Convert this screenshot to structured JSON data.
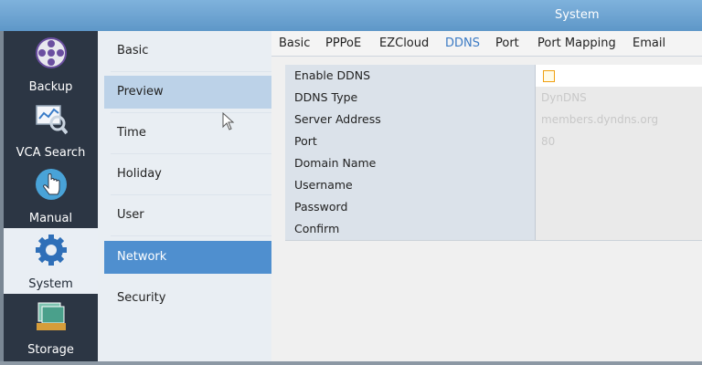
{
  "window": {
    "title": "System"
  },
  "nav": [
    {
      "label": "Backup",
      "icon": "film-reel-icon"
    },
    {
      "label": "VCA Search",
      "icon": "chart-magnifier-icon"
    },
    {
      "label": "Manual",
      "icon": "hand-pointer-icon"
    },
    {
      "label": "System",
      "icon": "gear-icon",
      "active": true
    },
    {
      "label": "Storage",
      "icon": "storage-icon"
    }
  ],
  "submenu": [
    {
      "label": "Basic"
    },
    {
      "label": "Preview"
    },
    {
      "label": "Time"
    },
    {
      "label": "Holiday"
    },
    {
      "label": "User"
    },
    {
      "label": "Network"
    },
    {
      "label": "Security"
    }
  ],
  "tabs": [
    "Basic",
    "PPPoE",
    "EZCloud",
    "DDNS",
    "Port",
    "Port Mapping",
    "Email"
  ],
  "active_tab": "DDNS",
  "form": {
    "enable_ddns": "Enable DDNS",
    "ddns_type": "DDNS Type",
    "ddns_type_value": "DynDNS",
    "server_address": "Server Address",
    "server_address_value": "members.dyndns.org",
    "port": "Port",
    "port_value": "80",
    "domain_name": "Domain Name",
    "username": "Username",
    "password": "Password",
    "confirm": "Confirm"
  },
  "colors": {
    "accent": "#4f8fcf",
    "nav_bg": "#2c3644",
    "checkbox": "#f0a010"
  }
}
